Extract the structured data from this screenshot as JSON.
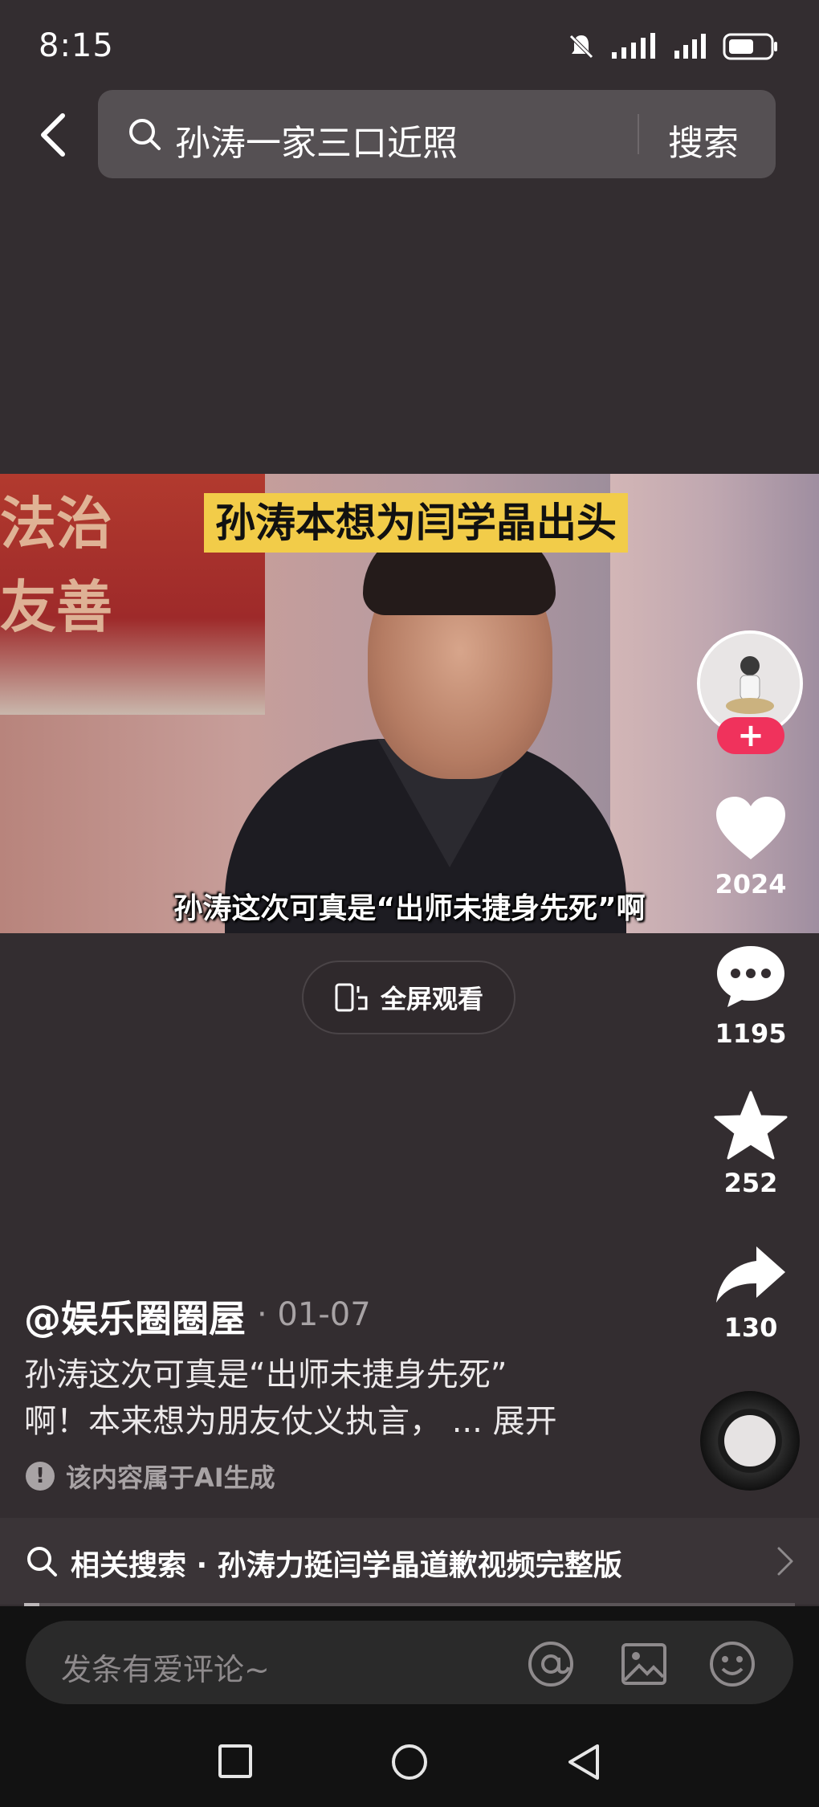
{
  "status": {
    "time": "8:15"
  },
  "search": {
    "query": "孙涛一家三口近照",
    "button": "搜索"
  },
  "video": {
    "title_caption": "孙涛本想为闫学晶出头",
    "subtitle": "孙涛这次可真是“出师未捷身先死”啊",
    "banner_text_line1": "法治",
    "banner_text_line2": "友善",
    "progress": 0.02
  },
  "fullscreen_label": "全屏观看",
  "rail": {
    "likes": "2024",
    "comments": "1195",
    "favorites": "252",
    "shares": "130",
    "follow_symbol": "+"
  },
  "post": {
    "author": "@娱乐圈圈屋",
    "date": "· 01-07",
    "desc_line1": "孙涛这次可真是“出师未捷身先死”",
    "desc_line2": "啊！本来想为朋友仗义执言，",
    "expand": "... 展开",
    "ai_note": "该内容属于AI生成",
    "ai_symbol": "!"
  },
  "related": {
    "text": "相关搜索 · 孙涛力挺闫学晶道歉视频完整版"
  },
  "comment": {
    "placeholder": "发条有爱评论~"
  },
  "colors": {
    "background": "#332d30",
    "follow": "#f0325c",
    "caption": "#f2cc49"
  }
}
